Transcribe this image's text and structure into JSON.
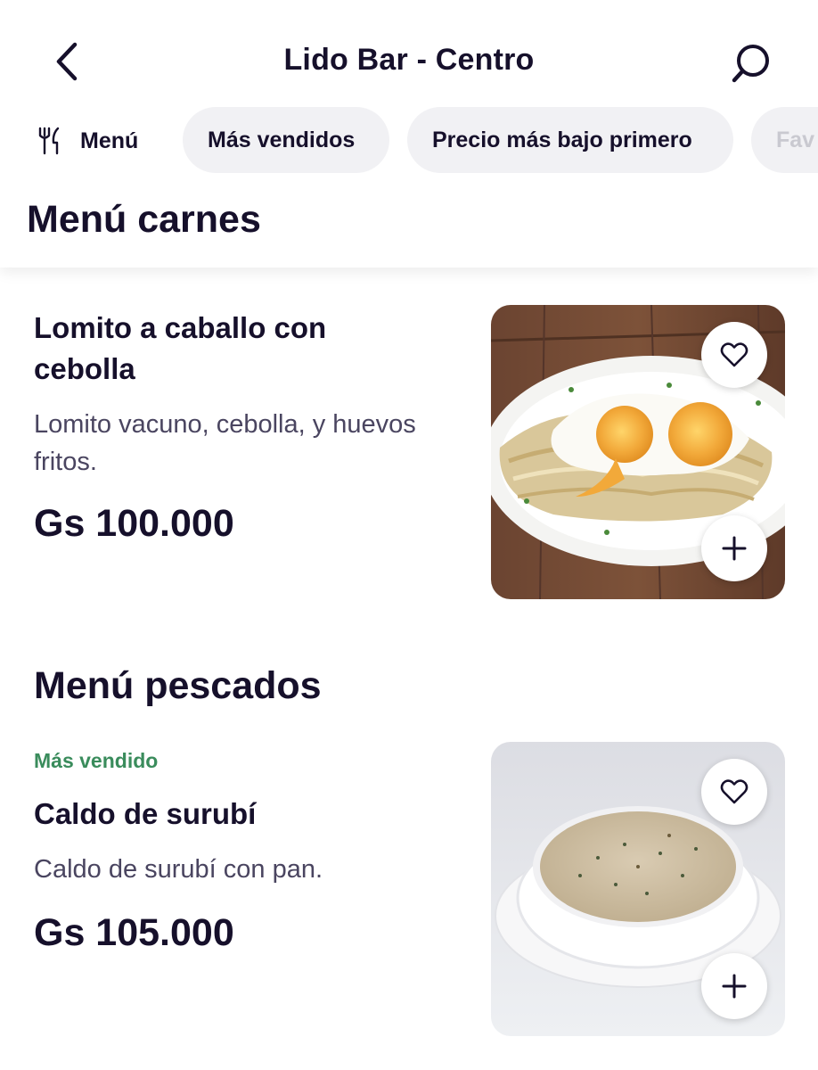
{
  "header": {
    "title": "Lido Bar - Centro",
    "back_icon": "chevron-left-icon",
    "search_icon": "search-icon"
  },
  "filters": {
    "menu_label": "Menú",
    "menu_icon": "fork-knife-icon",
    "chips": [
      "Más vendidos",
      "Precio más bajo primero",
      "Fav"
    ]
  },
  "sections": [
    {
      "title": "Menú carnes",
      "items": [
        {
          "name_line1": "Lomito a caballo con",
          "name_line2": "cebolla",
          "desc_line1": "Lomito vacuno, cebolla, y huevos",
          "desc_line2": "fritos.",
          "price": "Gs 100.000"
        }
      ]
    },
    {
      "title": "Menú pescados",
      "items": [
        {
          "badge": "Más vendido",
          "name": "Caldo de surubí",
          "desc": "Caldo de surubí con pan.",
          "price": "Gs 105.000"
        }
      ]
    }
  ],
  "colors": {
    "text": "#16102b",
    "chip_bg": "#f1f1f4",
    "badge_green": "#3a8c5c",
    "secondary_text": "#4a4560"
  }
}
